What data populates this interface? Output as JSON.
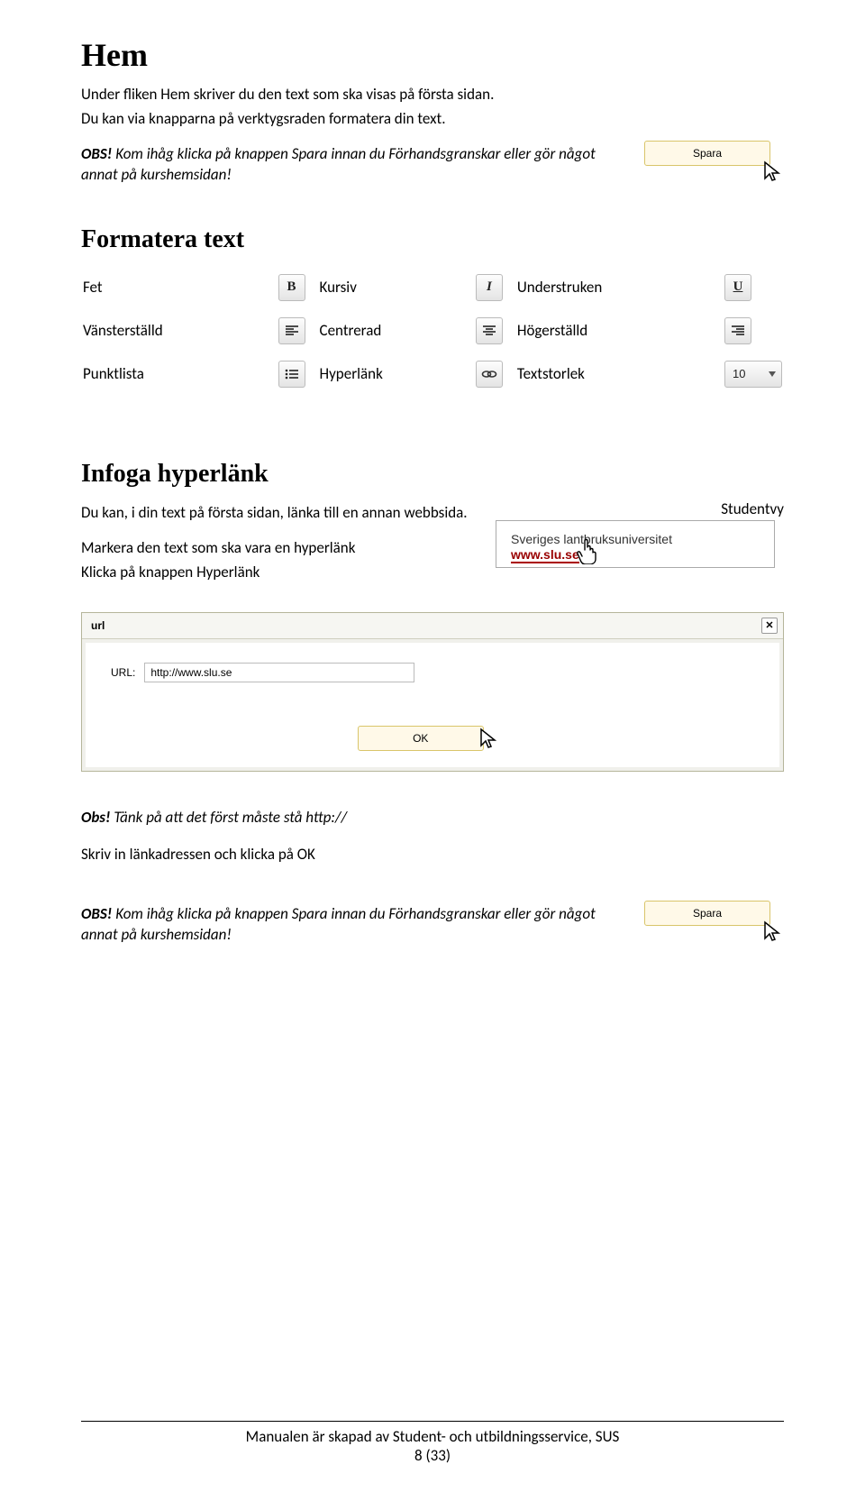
{
  "section_hem": {
    "title": "Hem",
    "intro1": "Under fliken Hem skriver du den text som ska visas på första sidan.",
    "intro2": "Du kan via knapparna på verktygsraden formatera din text.",
    "obs_prefix": "OBS! ",
    "obs_text": "Kom ihåg klicka på knappen Spara innan du Förhandsgranskar eller gör något annat på kurshemsidan!",
    "spara_label": "Spara"
  },
  "section_formatera": {
    "title": "Formatera text",
    "rows": [
      {
        "a": "Fet",
        "b": "Kursiv",
        "c": "Understruken"
      },
      {
        "a": "Vänsterställd",
        "b": "Centrerad",
        "c": "Högerställd"
      },
      {
        "a": "Punktlista",
        "b": "Hyperlänk",
        "c": "Textstorlek"
      }
    ],
    "bold_glyph": "B",
    "italic_glyph": "I",
    "underline_glyph": "U",
    "size_value": "10"
  },
  "section_infoga": {
    "title": "Infoga hyperlänk",
    "p1": "Du kan, i din text på första sidan, länka till en annan webbsida.",
    "p2": "Markera den text som ska vara en hyperlänk",
    "p3": "Klicka på knappen Hyperlänk",
    "studentvy_label": "Studentvy",
    "student_line1": "Sveriges lantbruksuniversitet",
    "student_link": "www.slu.se"
  },
  "url_dialog": {
    "title": "url",
    "field_label": "URL:",
    "value": "http://www.slu.se",
    "ok_label": "OK"
  },
  "obs_note": {
    "prefix": "Obs! ",
    "text": "Tänk på att det först måste stå  http://",
    "skrivin": "Skriv in länkadressen och klicka på OK"
  },
  "obs_final": {
    "prefix": "OBS! ",
    "text": "Kom ihåg klicka på knappen Spara innan du Förhandsgranskar eller gör något annat på kurshemsidan!",
    "spara_label": "Spara"
  },
  "footer": {
    "line1": "Manualen är skapad av Student- och utbildningsservice, SUS",
    "line2": "8 (33)"
  }
}
